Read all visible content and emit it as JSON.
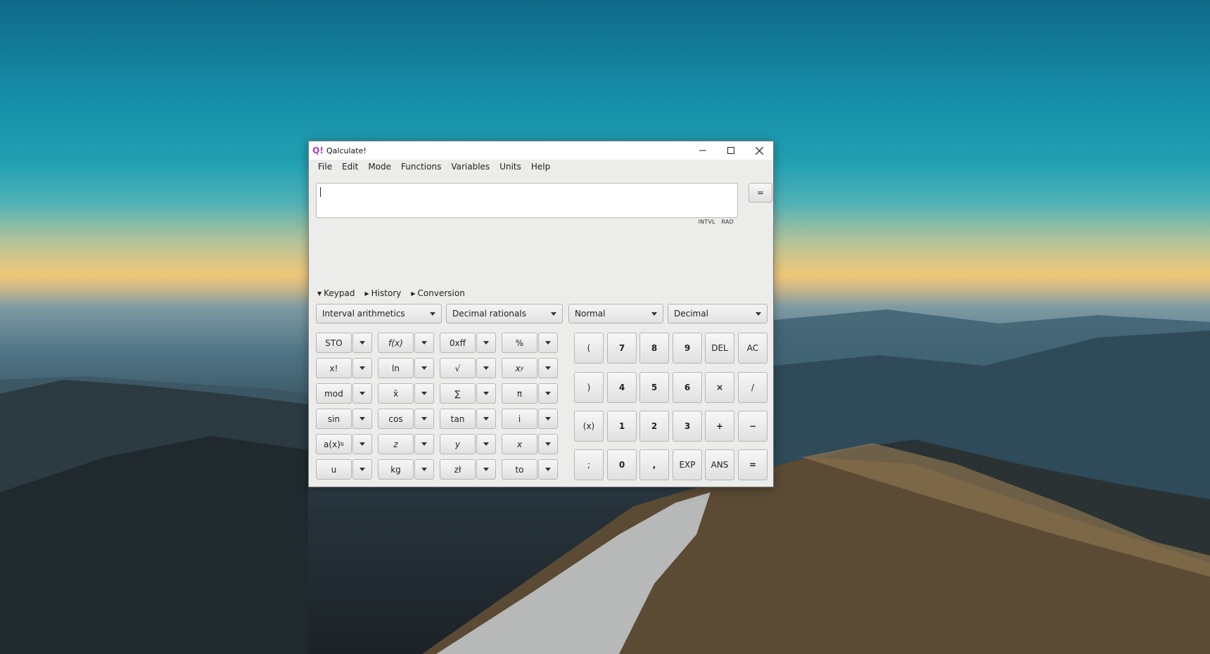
{
  "window": {
    "title": "Qalculate!",
    "app_icon": "Q!",
    "controls": {
      "minimize": "minimize-icon",
      "maximize": "maximize-icon",
      "close": "close-icon"
    }
  },
  "menubar": [
    "File",
    "Edit",
    "Mode",
    "Functions",
    "Variables",
    "Units",
    "Help"
  ],
  "expression": {
    "value": "",
    "equals_label": "="
  },
  "status": [
    "INTVL",
    "RAD"
  ],
  "sections": [
    "Keypad",
    "History",
    "Conversion"
  ],
  "combos": [
    "Interval arithmetics",
    "Decimal rationals",
    "Normal",
    "Decimal"
  ],
  "function_rows": [
    [
      "STO",
      "f(x)",
      "0xff",
      "%"
    ],
    [
      "x!",
      "ln",
      "√",
      "x"
    ],
    [
      "mod",
      "x̄",
      "∑",
      "π"
    ],
    [
      "sin",
      "cos",
      "tan",
      "i"
    ],
    [
      "a(x)",
      "z",
      "y",
      "x"
    ],
    [
      "u",
      "kg",
      "zł",
      "to"
    ]
  ],
  "superscripts": {
    "xy": "y",
    "axb": "b"
  },
  "numpad_rows": [
    [
      "(",
      "7",
      "8",
      "9",
      "DEL",
      "AC"
    ],
    [
      ")",
      "4",
      "5",
      "6",
      "×",
      "/"
    ],
    [
      "(x)",
      "1",
      "2",
      "3",
      "+",
      "−"
    ],
    [
      ";",
      "0",
      ",",
      "EXP",
      "ANS",
      "="
    ]
  ]
}
